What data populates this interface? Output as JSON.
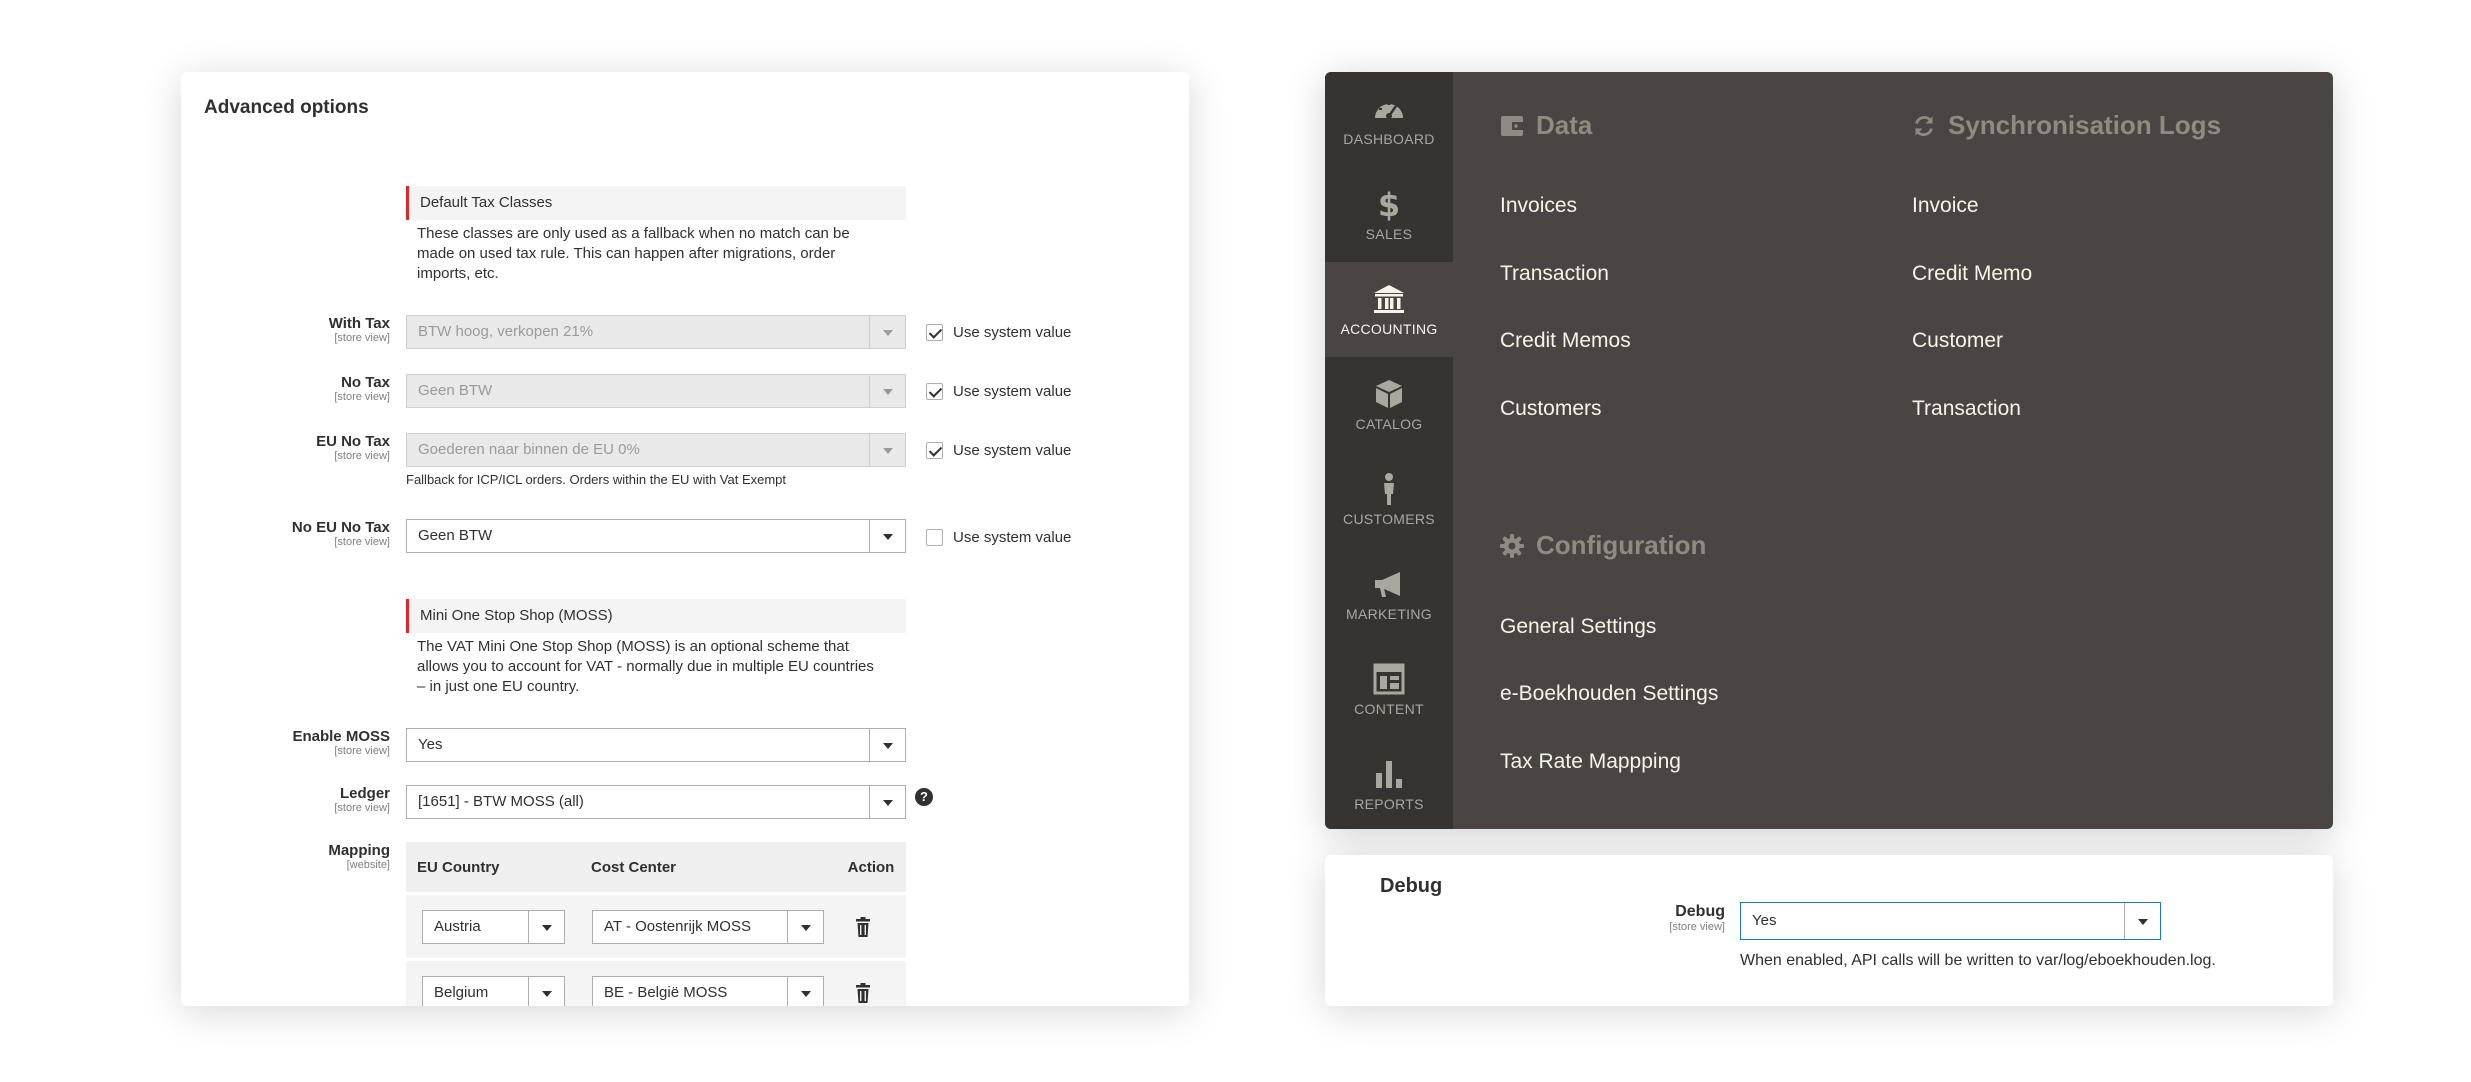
{
  "advanced": {
    "title": "Advanced options",
    "default_tax_classes": {
      "heading": "Default Tax Classes",
      "description": "These classes are only used as a fallback when no match can be made on used tax rule. This can happen after migrations, order imports, etc."
    },
    "fields": {
      "with_tax": {
        "label": "With Tax",
        "scope": "[store view]",
        "value": "BTW hoog, verkopen 21%",
        "use_system_value": true
      },
      "no_tax": {
        "label": "No Tax",
        "scope": "[store view]",
        "value": "Geen BTW",
        "use_system_value": true
      },
      "eu_no_tax": {
        "label": "EU No Tax",
        "scope": "[store view]",
        "value": "Goederen naar binnen de EU 0%",
        "use_system_value": true,
        "note": "Fallback for ICP/ICL orders. Orders within the EU with Vat Exempt"
      },
      "no_eu_no_tax": {
        "label": "No EU No Tax",
        "scope": "[store view]",
        "value": "Geen BTW",
        "use_system_value": false
      }
    },
    "use_system_value_label": "Use system value",
    "moss": {
      "heading": "Mini One Stop Shop (MOSS)",
      "description": "The VAT Mini One Stop Shop (MOSS) is an optional scheme that allows you to account for VAT - normally due in multiple EU countries – in just one EU country.",
      "enable": {
        "label": "Enable MOSS",
        "scope": "[store view]",
        "value": "Yes"
      },
      "ledger": {
        "label": "Ledger",
        "scope": "[store view]",
        "value": "[1651] - BTW MOSS (all)",
        "help": "?"
      },
      "mapping": {
        "label": "Mapping",
        "scope": "[website]",
        "columns": [
          "EU Country",
          "Cost Center",
          "Action"
        ],
        "rows": [
          {
            "country": "Austria",
            "cost_center": "AT - Oostenrijk MOSS"
          },
          {
            "country": "Belgium",
            "cost_center": "BE - België MOSS"
          }
        ]
      }
    }
  },
  "menu": {
    "sidebar": [
      {
        "label": "DASHBOARD",
        "icon": "dashboard-icon",
        "active": false
      },
      {
        "label": "SALES",
        "icon": "dollar-icon",
        "active": false
      },
      {
        "label": "ACCOUNTING",
        "icon": "bank-icon",
        "active": true
      },
      {
        "label": "CATALOG",
        "icon": "box-icon",
        "active": false
      },
      {
        "label": "CUSTOMERS",
        "icon": "person-icon",
        "active": false
      },
      {
        "label": "MARKETING",
        "icon": "megaphone-icon",
        "active": false
      },
      {
        "label": "CONTENT",
        "icon": "layout-icon",
        "active": false
      },
      {
        "label": "REPORTS",
        "icon": "bar-chart-icon",
        "active": false
      }
    ],
    "data": {
      "title": "Data",
      "icon": "wallet-icon",
      "links": [
        "Invoices",
        "Transaction",
        "Credit Memos",
        "Customers"
      ]
    },
    "sync_logs": {
      "title": "Synchronisation Logs",
      "icon": "sync-icon",
      "links": [
        "Invoice",
        "Credit Memo",
        "Customer",
        "Transaction"
      ]
    },
    "configuration": {
      "title": "Configuration",
      "icon": "gear-icon",
      "links": [
        "General Settings",
        "e-Boekhouden Settings",
        "Tax Rate Mappping"
      ]
    }
  },
  "debug": {
    "title": "Debug",
    "label": "Debug",
    "scope": "[store view]",
    "value": "Yes",
    "note": "When enabled, API calls will be written to var/log/eboekhouden.log."
  },
  "colors": {
    "menu_bg": "#4a4542",
    "sidebar_bg": "#373330",
    "menu_title": "#8f8a83",
    "menu_link": "#f7f3eb",
    "accent_red": "#e22626",
    "focus_blue": "#1979c3"
  }
}
